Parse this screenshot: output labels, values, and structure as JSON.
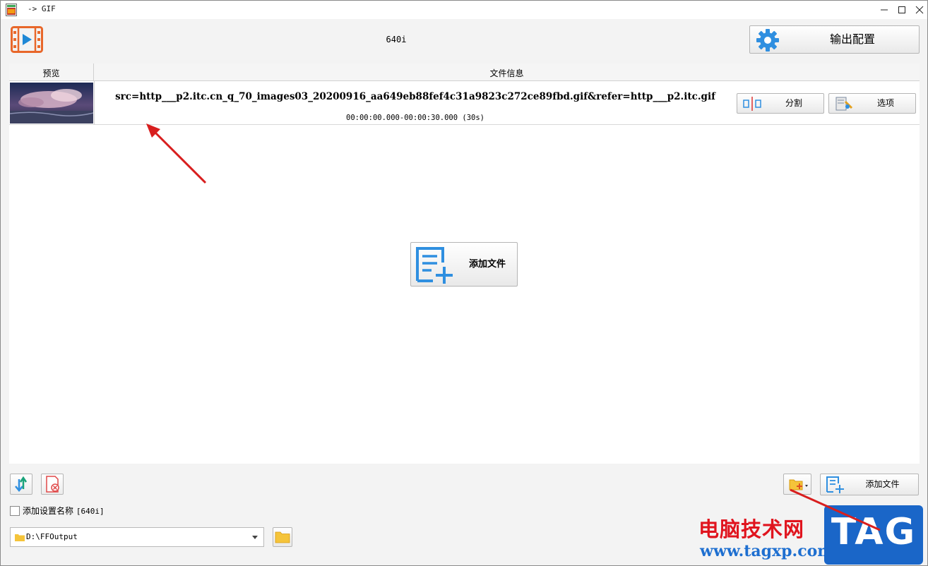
{
  "window": {
    "title": "-> GIF"
  },
  "header": {
    "profile_name": "640i",
    "output_config_label": "输出配置"
  },
  "file_list": {
    "columns": {
      "preview": "预览",
      "info": "文件信息"
    },
    "rows": [
      {
        "filename": "src=http___p2.itc.cn_q_70_images03_20200916_aa649eb88fef4c31a9823c272ce89fbd.gif&refer=http___p2.itc.gif",
        "time_range": "00:00:00.000-00:00:30.000 (30s)",
        "split_label": "分割",
        "options_label": "选项"
      }
    ]
  },
  "center": {
    "add_file_label": "添加文件"
  },
  "bottom": {
    "add_file_label": "添加文件",
    "add_profile_name_label": "添加设置名称",
    "add_profile_name_value": "[640i]",
    "add_profile_name_checked": false,
    "output_path": "D:\\FFOutput"
  },
  "watermark": {
    "cn": "电脑技术网",
    "url": "www.tagxp.com",
    "tag": "TAG"
  },
  "colors": {
    "accent_blue": "#1e88d6",
    "logo_orange": "#e8672a",
    "annotation_red": "#d81e1e"
  }
}
